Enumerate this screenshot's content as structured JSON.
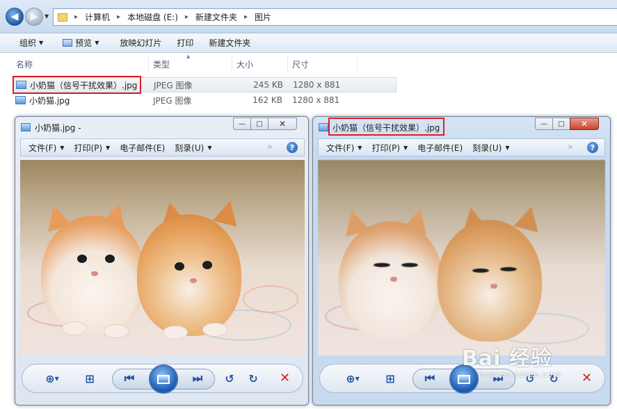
{
  "breadcrumb": {
    "items": [
      "计算机",
      "本地磁盘 (E:)",
      "新建文件夹",
      "图片"
    ],
    "separator": "▸"
  },
  "toolbar": {
    "organize": "组织",
    "preview": "预览",
    "slideshow": "放映幻灯片",
    "print": "打印",
    "new_folder": "新建文件夹"
  },
  "columns": {
    "name": "名称",
    "type": "类型",
    "size": "大小",
    "dimensions": "尺寸"
  },
  "files": [
    {
      "name": "小奶猫（信号干扰效果）.jpg",
      "type": "JPEG 图像",
      "size": "245 KB",
      "dimensions": "1280 x 881",
      "selected": true
    },
    {
      "name": "小奶猫.jpg",
      "type": "JPEG 图像",
      "size": "162 KB",
      "dimensions": "1280 x 881",
      "selected": false
    }
  ],
  "viewer_left": {
    "title": "小奶猫.jpg -",
    "menu": [
      "文件(F)",
      "打印(P)",
      "电子邮件(E)",
      "刻录(U)"
    ],
    "chevrons": "»",
    "help": "?"
  },
  "viewer_right": {
    "title": "小奶猫（信号干扰效果）.jpg",
    "menu": [
      "文件(F)",
      "打印(P)",
      "电子邮件(E)",
      "刻录(U)"
    ],
    "chevrons": "»",
    "help": "?"
  },
  "window_controls": {
    "minimize": "—",
    "maximize": "□",
    "close": "✕"
  },
  "watermark": {
    "brand": "Bai 经验",
    "url": "jingyan.baidu.com"
  },
  "colors": {
    "highlight_border": "#e31b23",
    "accent": "#2455a4"
  }
}
